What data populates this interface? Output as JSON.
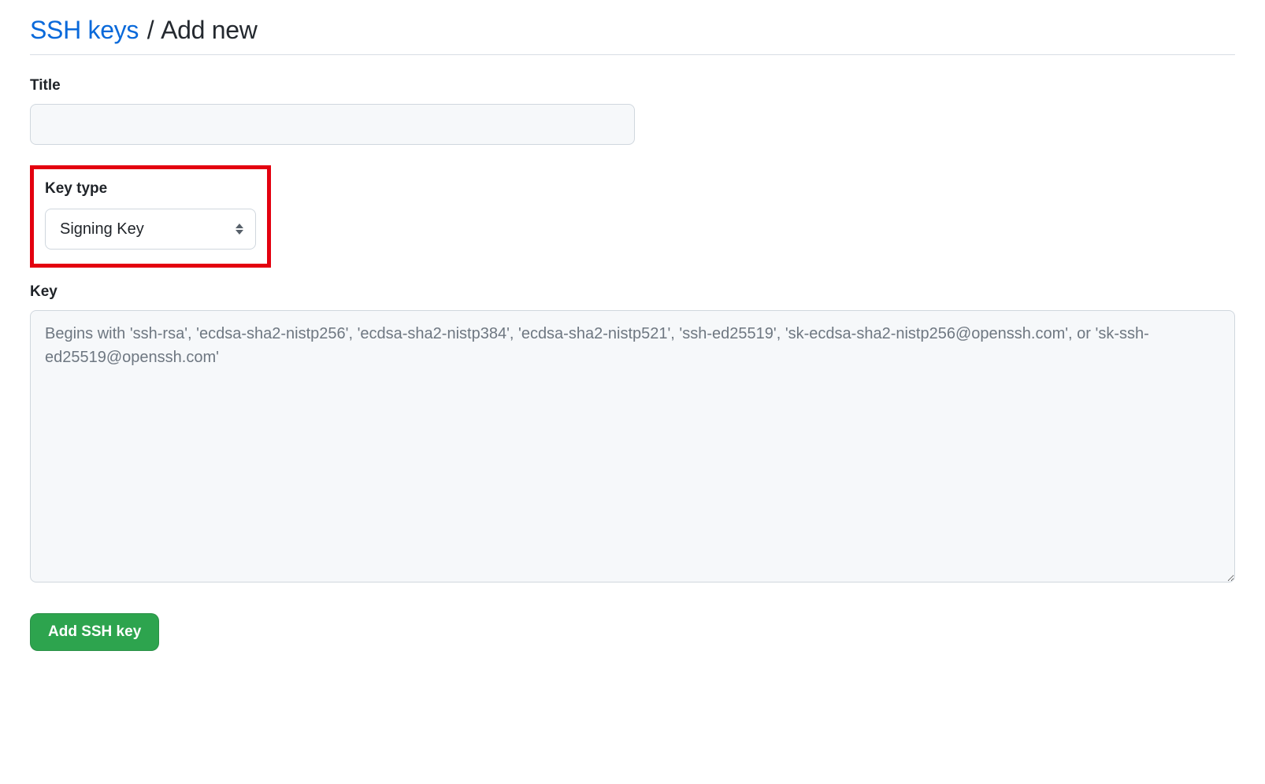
{
  "header": {
    "breadcrumb_link": "SSH keys",
    "separator": "/",
    "current": "Add new"
  },
  "form": {
    "title": {
      "label": "Title",
      "value": ""
    },
    "key_type": {
      "label": "Key type",
      "selected": "Signing Key"
    },
    "key": {
      "label": "Key",
      "value": "",
      "placeholder": "Begins with 'ssh-rsa', 'ecdsa-sha2-nistp256', 'ecdsa-sha2-nistp384', 'ecdsa-sha2-nistp521', 'ssh-ed25519', 'sk-ecdsa-sha2-nistp256@openssh.com', or 'sk-ssh-ed25519@openssh.com'"
    },
    "submit_label": "Add SSH key"
  }
}
